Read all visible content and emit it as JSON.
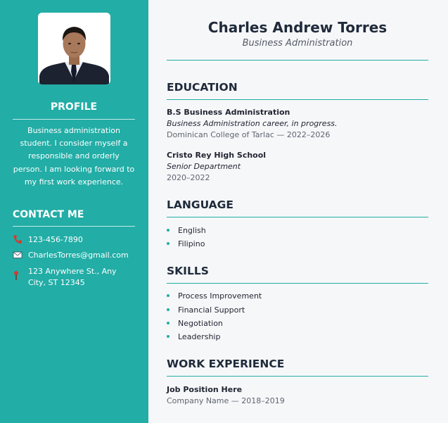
{
  "header": {
    "name": "Charles Andrew Torres",
    "title": "Business Administration"
  },
  "sidebar": {
    "profile_heading": "PROFILE",
    "profile_text": "Business administration student. I consider myself a responsible and orderly person. I am looking forward to my first work experience.",
    "contact_heading": "CONTACT ME",
    "contacts": [
      {
        "icon": "phone-icon",
        "text": "123-456-7890"
      },
      {
        "icon": "email-icon",
        "text": "CharlesTorres@gmail.com"
      },
      {
        "icon": "location-pin-icon",
        "text": "123 Anywhere St., Any City, ST 12345"
      }
    ]
  },
  "education": {
    "heading": "EDUCATION",
    "entries": [
      {
        "school": "B.S Business Administration",
        "detail": "Business Administration career, in progress.",
        "meta": "Dominican College of Tarlac — 2022–2026"
      },
      {
        "school": "Cristo Rey High School",
        "detail": "Senior Department",
        "meta": "2020–2022"
      }
    ]
  },
  "language": {
    "heading": "LANGUAGE",
    "items": [
      "English",
      "Filipino"
    ]
  },
  "skills": {
    "heading": "SKILLS",
    "items": [
      "Process Improvement",
      "Financial Support",
      "Negotiation",
      "Leadership"
    ]
  },
  "experience": {
    "heading": "WORK EXPERIENCE",
    "entries": [
      {
        "position": "Job Position Here",
        "meta": "Company Name — 2018–2019"
      }
    ]
  },
  "colors": {
    "accent": "#22ada6",
    "background": "#f6f7f9",
    "heading": "#1f2a3a"
  }
}
